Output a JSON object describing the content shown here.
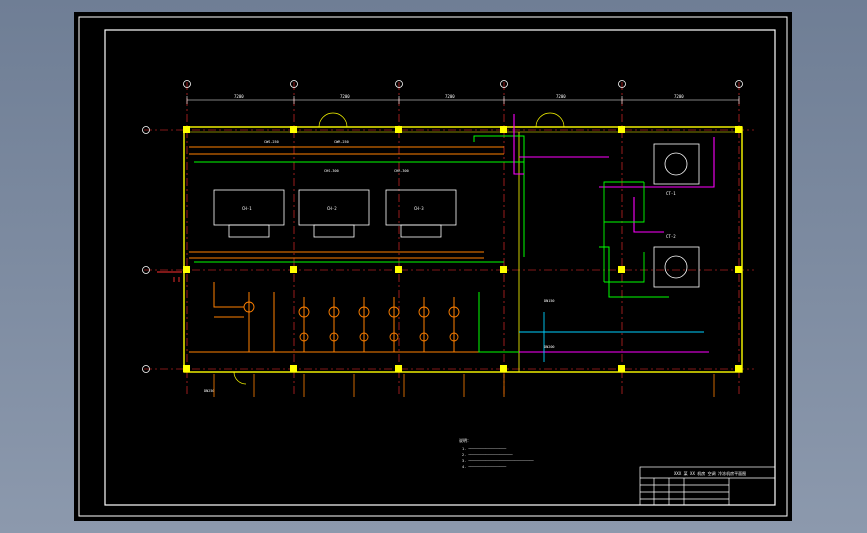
{
  "drawing": {
    "title_block_heading": "XXX 某 XX 机房 空调 冷冻机房平面图",
    "notes_heading": "说明：",
    "notes": [
      "1. ──────────────────",
      "2. ─────────────────────",
      "3. ───────────────────────────────",
      "4. ──────────────────"
    ],
    "dimensions": [
      "7200",
      "7200",
      "7200",
      "7200",
      "7200"
    ],
    "equipment_labels": [
      "CH-1",
      "CH-2",
      "CH-3",
      "CT-1",
      "CT-2"
    ],
    "pipe_labels": [
      "CWS-250",
      "CWR-250",
      "CHS-300",
      "CHR-300",
      "DN150",
      "DN200",
      "DN250"
    ]
  },
  "colors": {
    "wall": "#ffff00",
    "grid": "#ff3030",
    "chilled_water": "#ff8000",
    "condenser_water": "#00ff00",
    "supply_pipe": "#ff00ff",
    "drawing_line": "#ffffff",
    "cyan": "#00d0ff"
  }
}
